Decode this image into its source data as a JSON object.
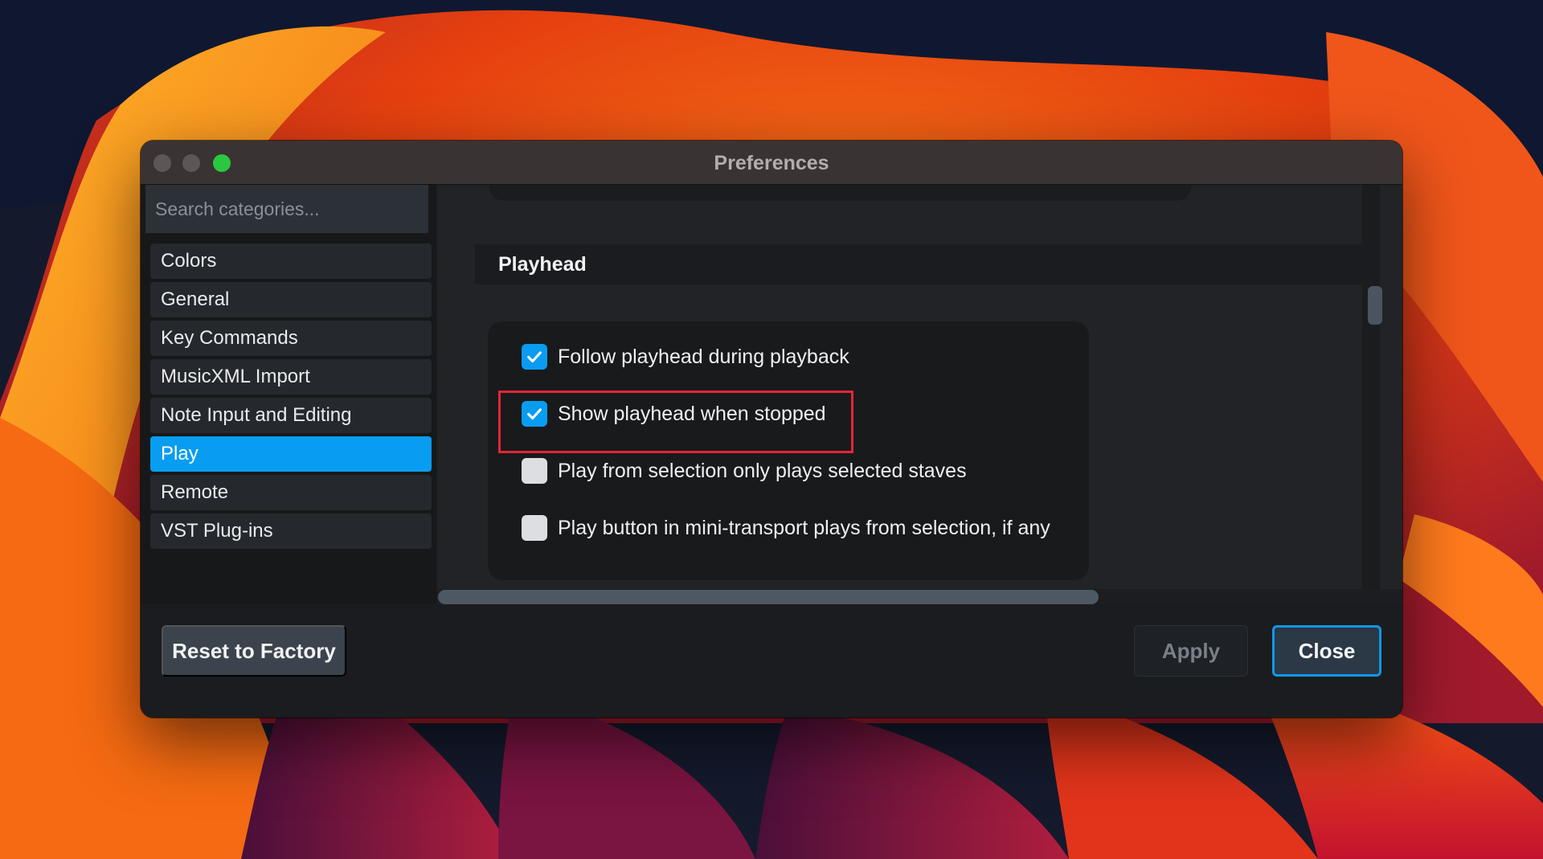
{
  "window": {
    "title": "Preferences",
    "traffic_lights": {
      "close_color": "#5d5657",
      "minimize_color": "#5d5657",
      "maximize_color": "#2ac840"
    }
  },
  "sidebar": {
    "search_placeholder": "Search categories...",
    "items": [
      {
        "label": "Colors",
        "active": false
      },
      {
        "label": "General",
        "active": false
      },
      {
        "label": "Key Commands",
        "active": false
      },
      {
        "label": "MusicXML Import",
        "active": false
      },
      {
        "label": "Note Input and Editing",
        "active": false
      },
      {
        "label": "Play",
        "active": true
      },
      {
        "label": "Remote",
        "active": false
      },
      {
        "label": "VST Plug-ins",
        "active": false
      }
    ],
    "active_color": "#089df1"
  },
  "content": {
    "section_title": "Playhead",
    "options": [
      {
        "label": "Follow playhead during playback",
        "checked": true
      },
      {
        "label": "Show playhead when stopped",
        "checked": true,
        "highlighted": true
      },
      {
        "label": "Play from selection only plays selected staves",
        "checked": false
      },
      {
        "label": "Play button in mini-transport plays from selection, if any",
        "checked": false
      }
    ],
    "highlight_color": "#e32636",
    "check_color": "#0a9cf0",
    "check_icon": "checkmark-icon"
  },
  "footer": {
    "reset_label": "Reset to Factory",
    "apply_label": "Apply",
    "apply_enabled": false,
    "close_label": "Close"
  }
}
